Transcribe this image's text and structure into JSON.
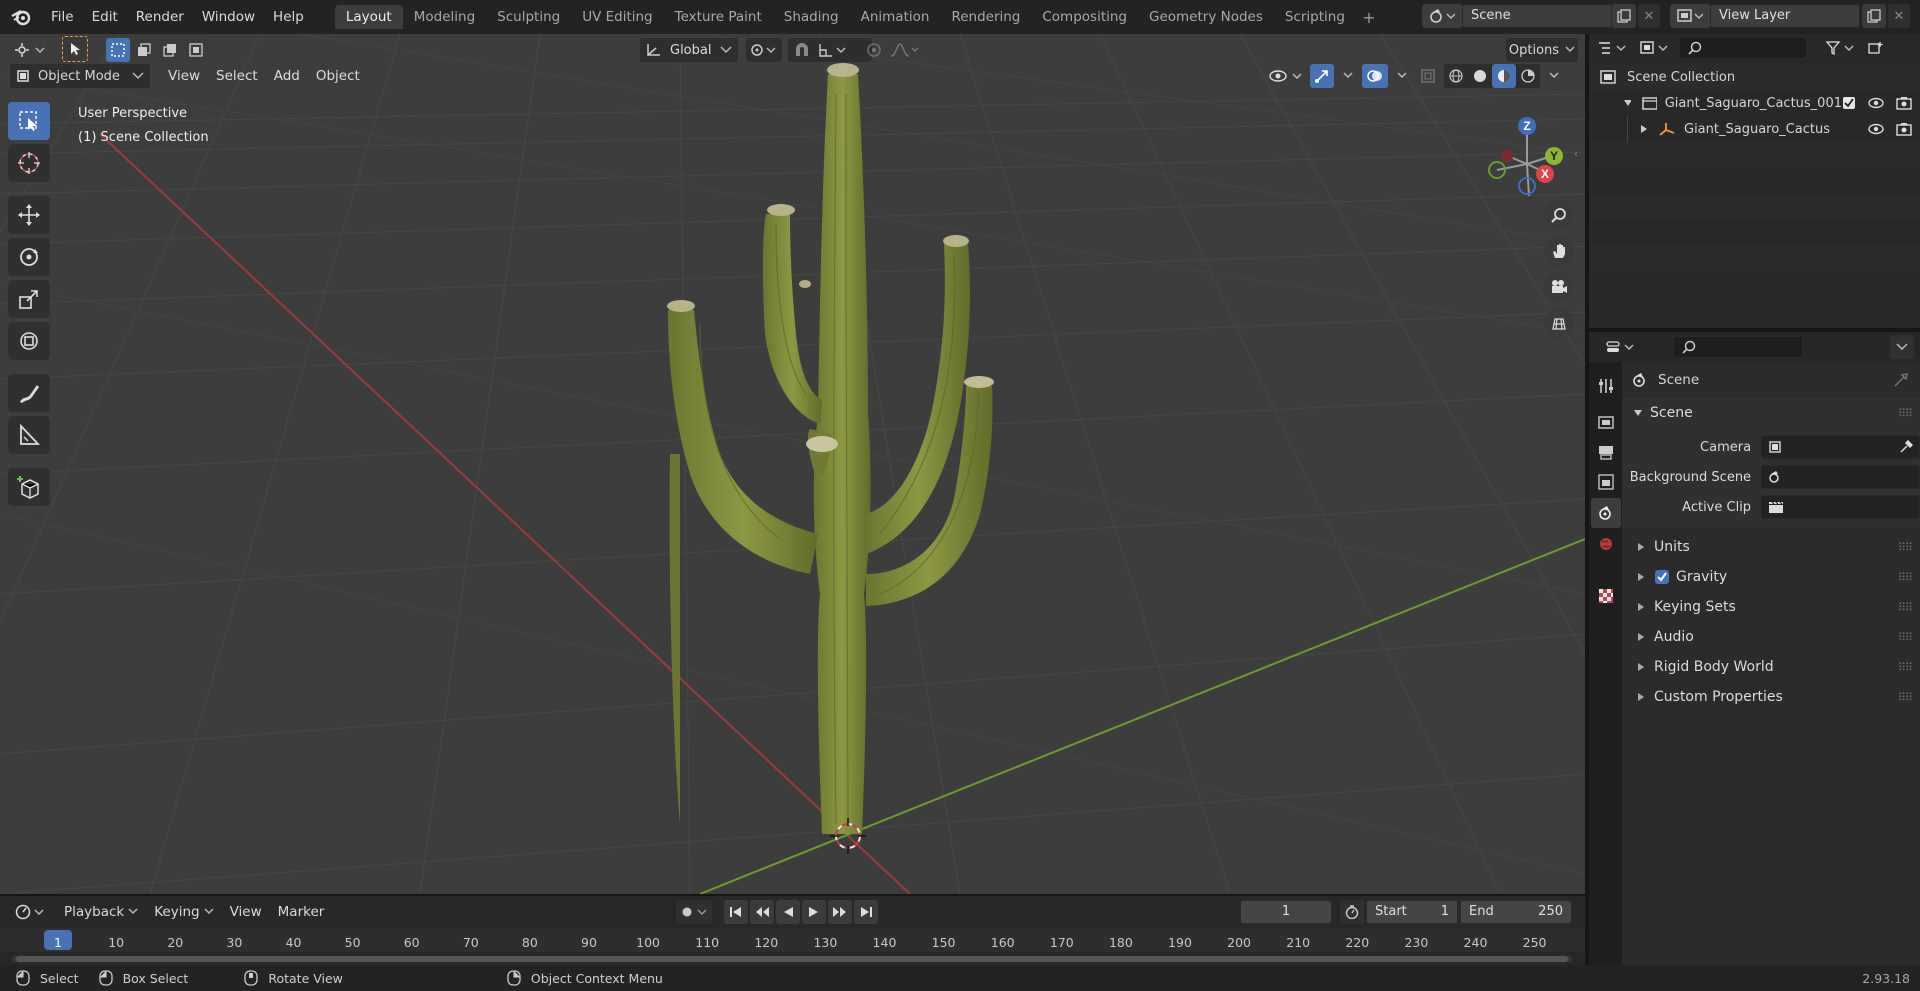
{
  "app": {
    "version": "2.93.18"
  },
  "topbar": {
    "menus": [
      "File",
      "Edit",
      "Render",
      "Window",
      "Help"
    ],
    "workspaces": [
      "Layout",
      "Modeling",
      "Sculpting",
      "UV Editing",
      "Texture Paint",
      "Shading",
      "Animation",
      "Rendering",
      "Compositing",
      "Geometry Nodes",
      "Scripting"
    ],
    "active_workspace": "Layout",
    "scene_name": "Scene",
    "view_layer": "View Layer"
  },
  "viewport": {
    "transform_orientation": "Global",
    "options_label": "Options",
    "mode": "Object Mode",
    "menus": [
      "View",
      "Select",
      "Add",
      "Object"
    ],
    "overlay_title": "User Perspective",
    "overlay_subtitle": "(1) Scene Collection",
    "gizmo_axes": {
      "z": "Z",
      "y": "Y",
      "x": "X"
    }
  },
  "outliner": {
    "root": "Scene Collection",
    "items": [
      {
        "label": "Giant_Saguaro_Cactus_001",
        "type": "collection"
      },
      {
        "label": "Giant_Saguaro_Cactus",
        "type": "object"
      }
    ]
  },
  "properties": {
    "context_title": "Scene",
    "section_title": "Scene",
    "fields": [
      {
        "label": "Camera"
      },
      {
        "label": "Background Scene"
      },
      {
        "label": "Active Clip"
      }
    ],
    "subpanels": [
      "Units",
      "Gravity",
      "Keying Sets",
      "Audio",
      "Rigid Body World",
      "Custom Properties"
    ],
    "gravity_checked": true
  },
  "timeline": {
    "menus": [
      "Playback",
      "Keying",
      "View",
      "Marker"
    ],
    "current_frame": "1",
    "start_label": "Start",
    "start_value": "1",
    "end_label": "End",
    "end_value": "250",
    "ruler": [
      "1",
      "10",
      "20",
      "30",
      "40",
      "50",
      "60",
      "70",
      "80",
      "90",
      "100",
      "110",
      "120",
      "130",
      "140",
      "150",
      "160",
      "170",
      "180",
      "190",
      "200",
      "210",
      "220",
      "230",
      "240",
      "250"
    ]
  },
  "statusbar": {
    "items": [
      "Select",
      "Box Select",
      "Rotate View",
      "Object Context Menu"
    ]
  },
  "colors": {
    "accent": "#4772b3",
    "cactus": "#7f8a3a",
    "x_axis": "#b03a3a",
    "y_axis": "#6f9a2e"
  }
}
